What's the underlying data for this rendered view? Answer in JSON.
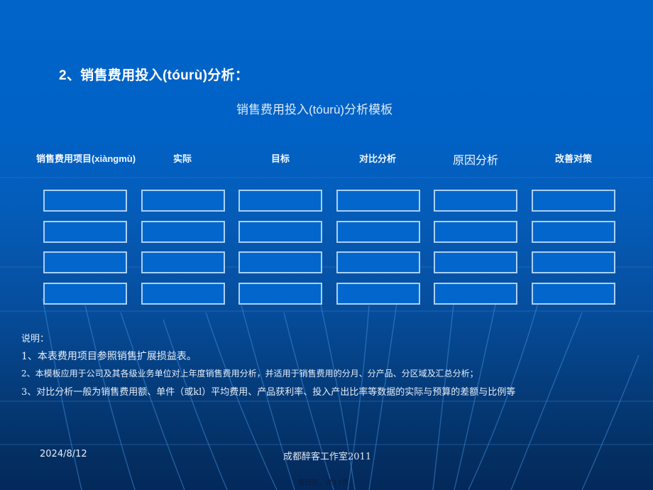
{
  "slide": {
    "title": "2、销售费用投入(tóurù)分析：",
    "subtitle": "销售费用投入(tóurù)分析模板"
  },
  "table": {
    "headers": [
      {
        "label": "销售费用项目(xiàngmù)",
        "emphasis": false
      },
      {
        "label": "实际",
        "emphasis": false
      },
      {
        "label": "目标",
        "emphasis": false
      },
      {
        "label": "对比分析",
        "emphasis": false
      },
      {
        "label": "原因分析",
        "emphasis": true
      },
      {
        "label": "改善对策",
        "emphasis": false
      }
    ],
    "rows": 4,
    "cells": [
      [
        "",
        "",
        "",
        "",
        "",
        ""
      ],
      [
        "",
        "",
        "",
        "",
        "",
        ""
      ],
      [
        "",
        "",
        "",
        "",
        "",
        ""
      ],
      [
        "",
        "",
        "",
        "",
        "",
        ""
      ]
    ]
  },
  "notes": {
    "heading": "说明：",
    "items": [
      "1、本表费用项目参照销售扩展损益表。",
      "2、本模板应用于公司及其各级业务单位对上年度销售费用分析，并适用于销售费用的分月、分产品、分区域及汇总分析；",
      "3、对比分析一般为销售费用额、单件（或kl）平均费用、产品获利率、投入产出比率等数据的实际与预算的差额与比例等"
    ]
  },
  "footer": {
    "date": "2024/8/12",
    "organization": "成都醉客工作室2011",
    "page_indicator": "第四页，共17页。"
  },
  "colors": {
    "background_top": "#0064c8",
    "background_bottom": "#03295a",
    "cell_fill": "#0366cc",
    "cell_border": "#a9d0f5",
    "text": "#ffffff"
  }
}
